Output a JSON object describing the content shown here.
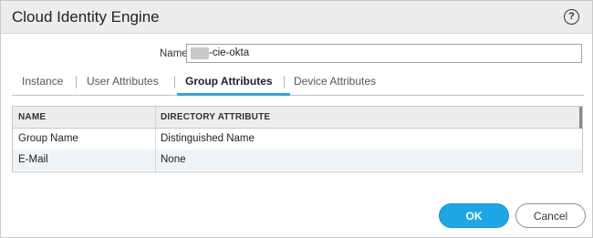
{
  "dialog": {
    "title": "Cloud Identity Engine",
    "help_icon": "help-circle-icon"
  },
  "form": {
    "name_label": "Name",
    "name_value": "-cie-okta"
  },
  "tabs": [
    {
      "label": "Instance",
      "active": false
    },
    {
      "label": "User Attributes",
      "active": false
    },
    {
      "label": "Group Attributes",
      "active": true
    },
    {
      "label": "Device Attributes",
      "active": false
    }
  ],
  "table": {
    "columns": [
      "NAME",
      "DIRECTORY ATTRIBUTE"
    ],
    "rows": [
      [
        "Group Name",
        "Distinguished Name"
      ],
      [
        "E-Mail",
        "None"
      ]
    ]
  },
  "buttons": {
    "ok": "OK",
    "cancel": "Cancel"
  },
  "colors": {
    "accent": "#1ea7e4",
    "tab_underline": "#35a3d8",
    "alt_row": "#eef3f7"
  }
}
